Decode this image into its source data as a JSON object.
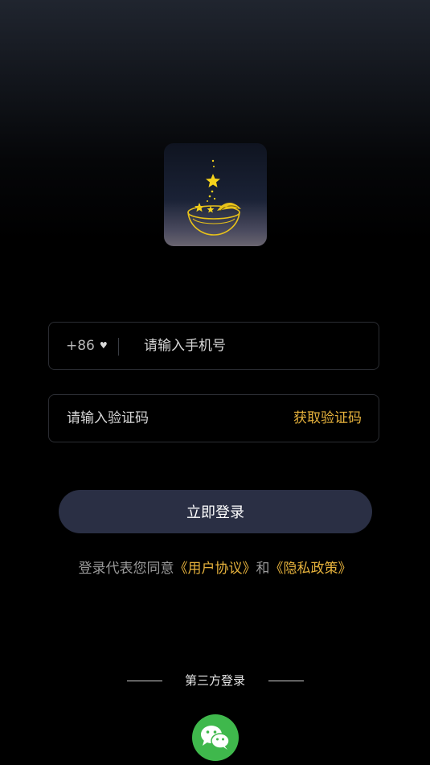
{
  "logo": {
    "name": "app-logo-bowl-stars-icon"
  },
  "phone": {
    "country_code": "+86",
    "placeholder": "请输入手机号",
    "value": ""
  },
  "code": {
    "placeholder": "请输入验证码",
    "value": "",
    "get_code_label": "获取验证码"
  },
  "login_button": "立即登录",
  "agreement": {
    "prefix": "登录代表您同意",
    "user_agreement": "《用户协议》",
    "and": "和",
    "privacy_policy": "《隐私政策》"
  },
  "third_party": {
    "label": "第三方登录",
    "wechat_icon": "wechat-icon"
  },
  "colors": {
    "accent": "#e5b13c",
    "button_bg": "#2a2f44",
    "wechat_green": "#3fb84c"
  }
}
